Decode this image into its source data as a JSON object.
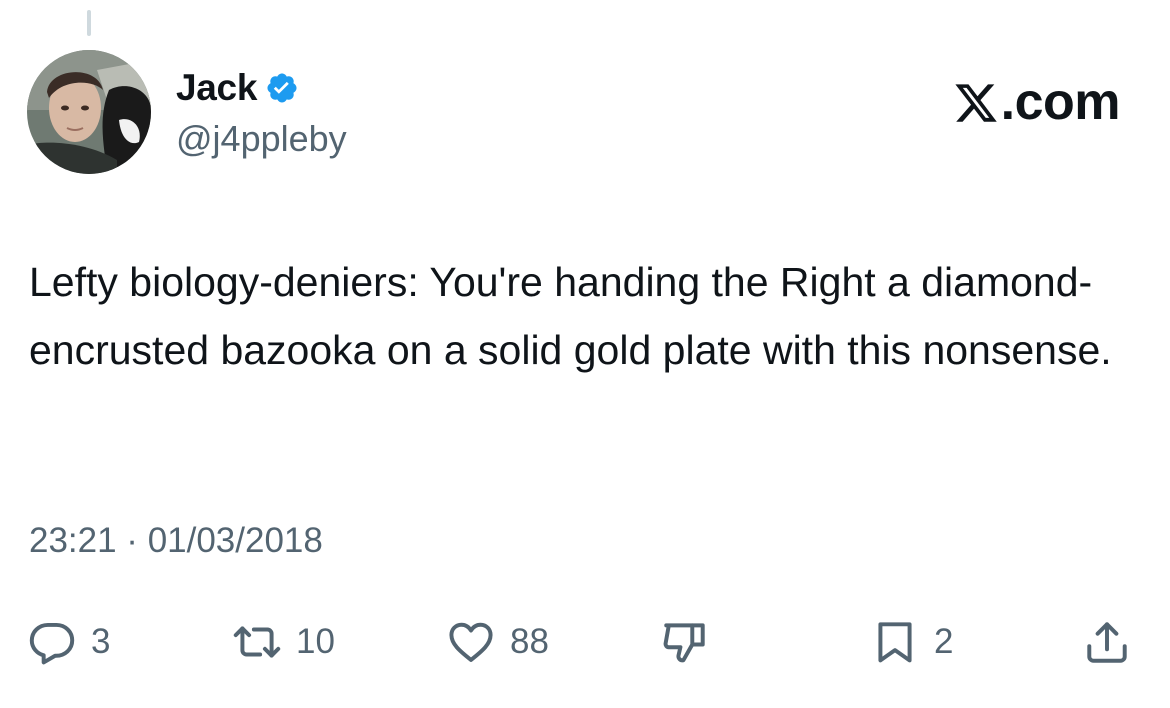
{
  "author": {
    "name": "Jack",
    "handle": "@j4ppleby",
    "verified": true,
    "verified_color": "#1d9bf0"
  },
  "brand": {
    "label": ".com",
    "icon": "x-logo-icon"
  },
  "tweet": {
    "text": "Lefty biology-deniers: You're handing the Right a diamond-encrusted bazooka on a solid gold plate with this nonsense.",
    "timestamp": "23:21 · 01/03/2018"
  },
  "actions": {
    "reply": {
      "icon": "reply-icon",
      "count": "3"
    },
    "repost": {
      "icon": "repost-icon",
      "count": "10"
    },
    "like": {
      "icon": "heart-icon",
      "count": "88"
    },
    "dislike": {
      "icon": "thumbs-down-icon"
    },
    "bookmark": {
      "icon": "bookmark-icon",
      "count": "2"
    },
    "share": {
      "icon": "share-icon"
    }
  },
  "colors": {
    "text": "#0f1419",
    "secondary": "#536471",
    "thread_line": "#cfd9de"
  }
}
